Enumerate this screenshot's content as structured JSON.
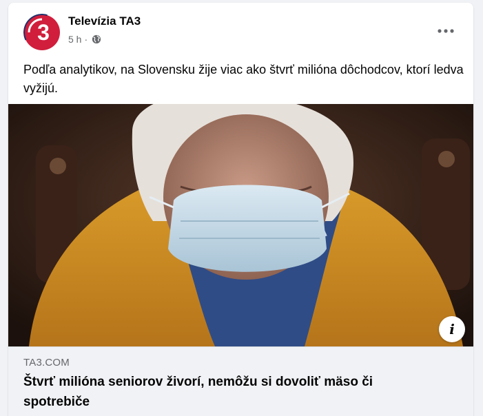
{
  "post": {
    "page_name": "Televízia TA3",
    "timestamp": "5 h",
    "separator": "·",
    "privacy_icon": "globe-icon",
    "more_icon": "more-options-icon",
    "text": "Podľa analytikov, na Slovensku žije viac ako štvrť milióna dôchodcov, ktorí ledva vyžijú.",
    "avatar_label": "3",
    "brand_color": "#d01e3c"
  },
  "link_preview": {
    "domain": "TA3.COM",
    "title": "Štvrť milióna seniorov živorí, nemôžu si dovoliť mäso či spotrebiče",
    "info_label": "i"
  }
}
